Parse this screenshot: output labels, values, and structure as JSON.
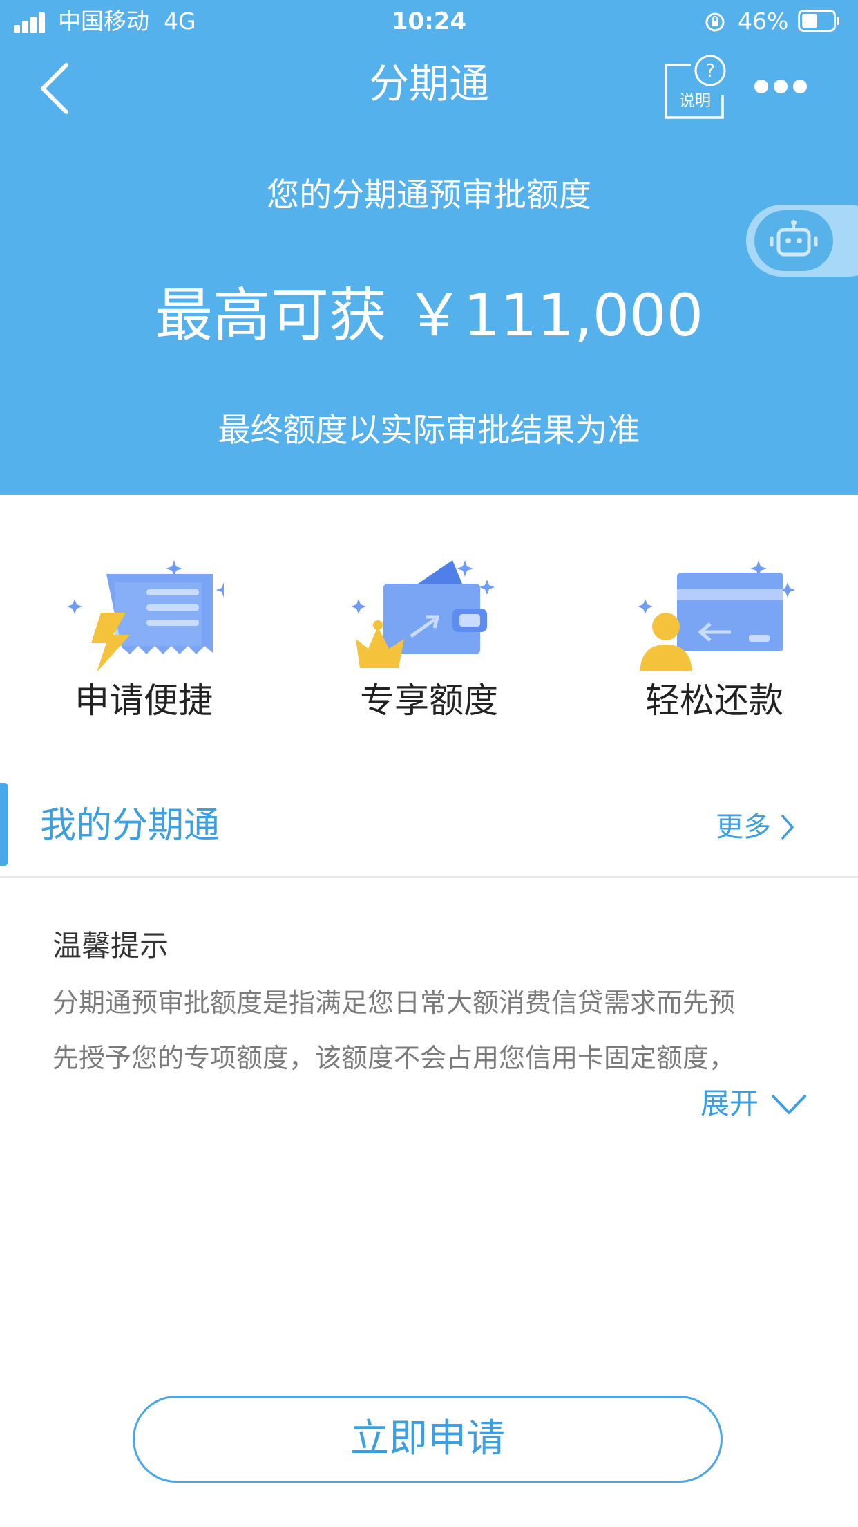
{
  "colors": {
    "header_blue": "#55b1ec",
    "accent_blue": "#3d9fe0",
    "button_border": "#4aa8e8",
    "tip_text": "#7b7b7b"
  },
  "status_bar": {
    "carrier": "中国移动",
    "network": "4G",
    "time": "10:24",
    "battery": "46%"
  },
  "nav": {
    "title": "分期通",
    "help_label": "说明",
    "back_icon": "chevron-left-icon",
    "more_icon": "ellipsis-icon"
  },
  "hero": {
    "subtitle": "您的分期通预审批额度",
    "amount_prefix": "最高可获",
    "amount": "￥111,000",
    "note": "最终额度以实际审批结果为准"
  },
  "features": [
    {
      "label": "申请便捷",
      "icon": "receipt-lightning-icon"
    },
    {
      "label": "专享额度",
      "icon": "wallet-crown-icon"
    },
    {
      "label": "轻松还款",
      "icon": "card-user-icon"
    }
  ],
  "my_section": {
    "title": "我的分期通",
    "more_label": "更多"
  },
  "tips": {
    "title": "温馨提示",
    "lines": [
      "分期通预审批额度是指满足您日常大额消费信贷需求而先预",
      "先授予您的专项额度，该额度不会占用您信用卡固定额度，"
    ],
    "expand_label": "展开"
  },
  "apply_button": {
    "label": "立即申请"
  }
}
